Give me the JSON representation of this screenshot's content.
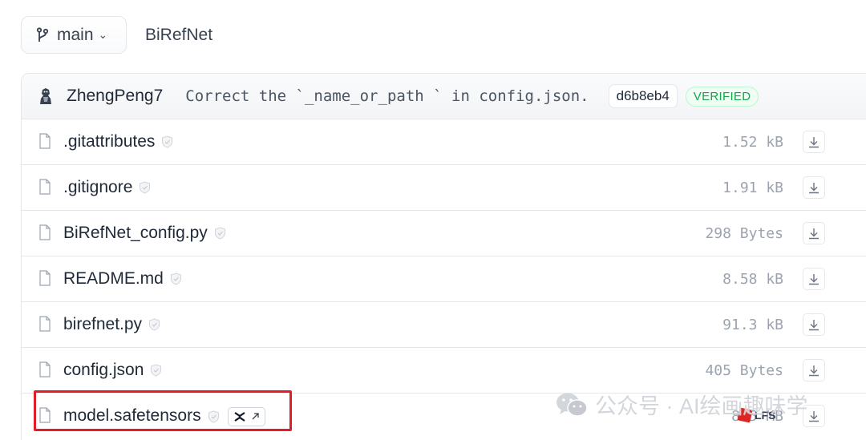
{
  "branch": {
    "label": "main",
    "icon": "git-branch-icon"
  },
  "repo": {
    "name": "BiRefNet"
  },
  "commit": {
    "author": "ZhengPeng7",
    "message": "Correct the `_name_or_path ` in config.json.",
    "hash": "d6b8eb4",
    "status": "VERIFIED"
  },
  "files": [
    {
      "name": ".gitattributes",
      "size": "1.52 kB"
    },
    {
      "name": ".gitignore",
      "size": "1.91 kB"
    },
    {
      "name": "BiRefNet_config.py",
      "size": "298 Bytes"
    },
    {
      "name": "README.md",
      "size": "8.58 kB"
    },
    {
      "name": "birefnet.py",
      "size": "91.3 kB"
    },
    {
      "name": "config.json",
      "size": "405 Bytes"
    },
    {
      "name": "model.safetensors",
      "size": "885 MB",
      "lfs": "LFS"
    }
  ],
  "watermark": {
    "text": "公众号 · AI绘画趣味学"
  },
  "colors": {
    "highlight": "#e11d2a",
    "verified": "#16a34a",
    "lfs": "#dc2626"
  }
}
